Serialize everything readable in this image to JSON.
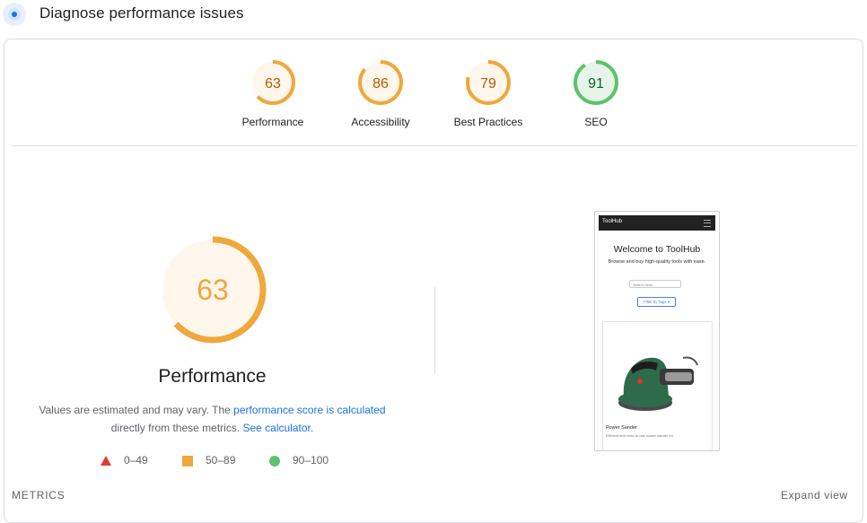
{
  "header": {
    "title": "Diagnose performance issues"
  },
  "scores": [
    {
      "label": "Performance",
      "score": "63",
      "value": 63,
      "status": "average"
    },
    {
      "label": "Accessibility",
      "score": "86",
      "value": 86,
      "status": "average"
    },
    {
      "label": "Best Practices",
      "score": "79",
      "value": 79,
      "status": "average"
    },
    {
      "label": "SEO",
      "score": "91",
      "value": 91,
      "status": "pass"
    }
  ],
  "main": {
    "score": "63",
    "value": 63,
    "title": "Performance",
    "desc_1": "Values are estimated and may vary. The ",
    "desc_link_1": "performance score is calculated",
    "desc_2": "directly from these metrics. ",
    "desc_link_2": "See calculator",
    "desc_3": "."
  },
  "legend": [
    {
      "range": "0–49",
      "shape": "triangle",
      "color": "#e53935"
    },
    {
      "range": "50–89",
      "shape": "square",
      "color": "#f0a73c"
    },
    {
      "range": "90–100",
      "shape": "circle",
      "color": "#5ec26a"
    }
  ],
  "footer": {
    "metrics": "METRICS",
    "expand": "Expand view"
  },
  "preview": {
    "brand": "ToolHub",
    "heading": "Welcome to ToolHub",
    "subtext": "Browse and buy high-quality tools with ease.",
    "search_placeholder": "Search tools...",
    "filter_label": "Filter by Tags ▾",
    "product_name": "Power Sander",
    "product_desc": "Efficient and easy-to-use power sander for"
  },
  "colors": {
    "average_stroke": "#f0a73c",
    "average_fill": "#fff6ec",
    "average_text": "#b35c00",
    "pass_stroke": "#5ec26a",
    "pass_fill": "#e6f4ea",
    "pass_text": "#0d652d",
    "link": "#1a73e8"
  }
}
